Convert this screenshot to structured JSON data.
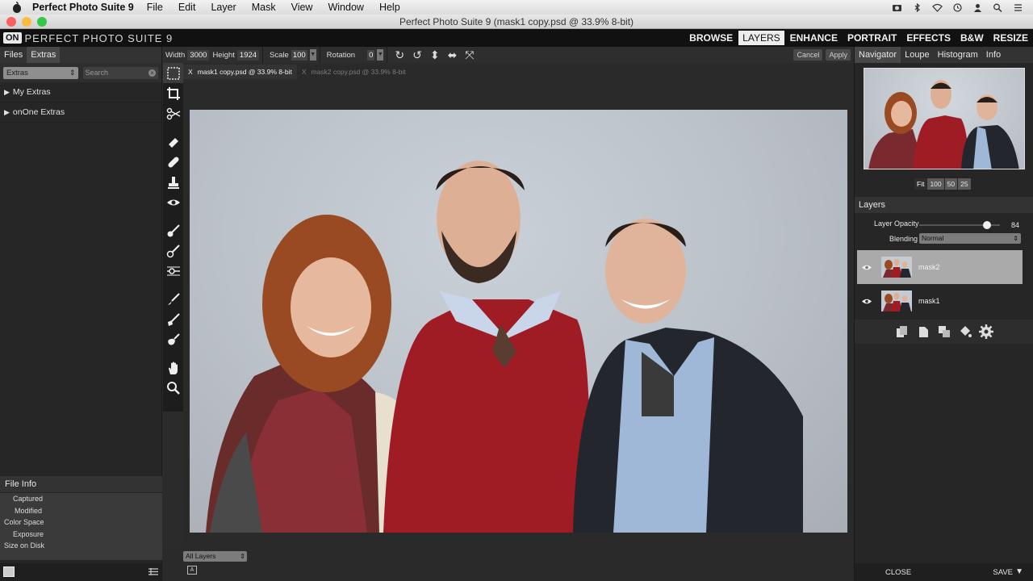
{
  "menubar": {
    "app_name": "Perfect Photo Suite 9",
    "items": [
      "File",
      "Edit",
      "Layer",
      "Mask",
      "View",
      "Window",
      "Help"
    ]
  },
  "window": {
    "title": "Perfect Photo Suite 9 (mask1 copy.psd @ 33.9% 8-bit)"
  },
  "appbar": {
    "logo_mark": "ON",
    "logo_text": "PERFECT PHOTO SUITE 9",
    "modules": [
      "BROWSE",
      "LAYERS",
      "ENHANCE",
      "PORTRAIT",
      "EFFECTS",
      "B&W",
      "RESIZE"
    ],
    "active_module": "LAYERS"
  },
  "left_panel": {
    "tabs": [
      "Files",
      "Extras"
    ],
    "active_tab": "Extras",
    "extras_select": "Extras",
    "search_placeholder": "Search",
    "items": [
      "My Extras",
      "onOne Extras"
    ],
    "file_info_title": "File Info",
    "file_info_rows": [
      "Captured",
      "Modified",
      "Color Space",
      "Exposure",
      "Size on Disk"
    ]
  },
  "options": {
    "width_label": "Width",
    "width_value": "3000",
    "height_label": "Height",
    "height_value": "1924",
    "scale_label": "Scale",
    "scale_value": "100",
    "rotation_label": "Rotation",
    "rotation_value": "0",
    "cancel_label": "Cancel",
    "apply_label": "Apply"
  },
  "doc_tabs": [
    {
      "close": "X",
      "label": "mask1 copy.psd @ 33.9% 8-bit",
      "active": true
    },
    {
      "close": "X",
      "label": "mask2 copy.psd @ 33.9% 8-bit",
      "active": false
    }
  ],
  "canvas_bottom": {
    "layers_select": "All Layers",
    "a_icon": "A"
  },
  "right_panel": {
    "tabs": [
      "Navigator",
      "Loupe",
      "Histogram",
      "Info"
    ],
    "active_tab": "Navigator",
    "zoom_buttons": [
      "Fit",
      "100",
      "50",
      "25"
    ],
    "active_zoom": "Fit",
    "layers_title": "Layers",
    "opacity_label": "Layer Opacity",
    "opacity_value": 84,
    "blending_label": "Blending",
    "blending_value": "Normal",
    "layers": [
      {
        "name": "mask2",
        "selected": true
      },
      {
        "name": "mask1",
        "selected": false
      }
    ],
    "close_label": "CLOSE",
    "save_label": "SAVE"
  },
  "icons": {
    "tools": [
      "marquee-tool-icon",
      "crop-tool-icon",
      "scissors-icon",
      "eraser-icon",
      "bandage-icon",
      "stamp-icon",
      "eye-icon",
      "masking-brush-icon",
      "masking-brush-2-icon",
      "line-mask-icon",
      "refine-brush-icon",
      "chisel-icon",
      "blur-icon",
      "hand-icon",
      "zoom-icon"
    ]
  },
  "colors": {
    "active_module_bg": "#ededed",
    "panel_bg": "#262626",
    "selected_layer_bg": "#aaaaaa"
  }
}
